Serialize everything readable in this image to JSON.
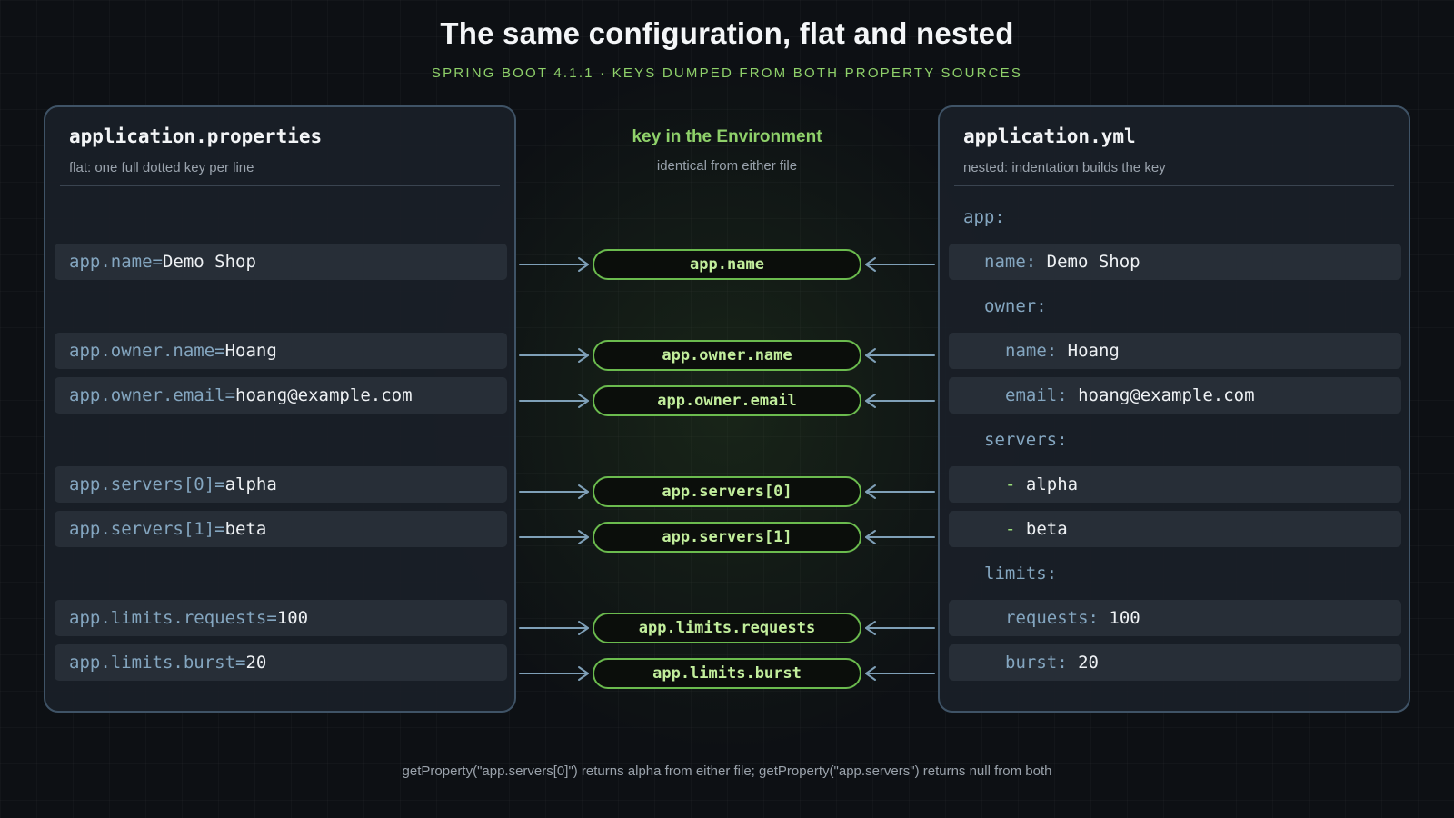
{
  "title": "The same configuration, flat and nested",
  "subtitle": "SPRING BOOT 4.1.1 · KEYS DUMPED FROM BOTH PROPERTY SOURCES",
  "left_panel": {
    "title": "application.properties",
    "subtitle": "flat: one full dotted key per line",
    "lines": [
      {
        "key": "app.name",
        "eq": "=",
        "value": "Demo Shop"
      },
      {
        "key": "app.owner.name",
        "eq": "=",
        "value": "Hoang"
      },
      {
        "key": "app.owner.email",
        "eq": "=",
        "value": "hoang@example.com"
      },
      {
        "key": "app.servers[0]",
        "eq": "=",
        "value": "alpha"
      },
      {
        "key": "app.servers[1]",
        "eq": "=",
        "value": "beta"
      },
      {
        "key": "app.limits.requests",
        "eq": "=",
        "value": "100"
      },
      {
        "key": "app.limits.burst",
        "eq": "=",
        "value": "20"
      }
    ]
  },
  "center": {
    "title": "key in the Environment",
    "subtitle": "identical from either file",
    "keys": [
      "app.name",
      "app.owner.name",
      "app.owner.email",
      "app.servers[0]",
      "app.servers[1]",
      "app.limits.requests",
      "app.limits.burst"
    ]
  },
  "right_panel": {
    "title": "application.yml",
    "subtitle": "nested: indentation builds the key",
    "lines": [
      {
        "key": "app:",
        "value": "",
        "dash": ""
      },
      {
        "key": "name:",
        "value": "Demo Shop",
        "dash": ""
      },
      {
        "key": "owner:",
        "value": "",
        "dash": ""
      },
      {
        "key": "name:",
        "value": "Hoang",
        "dash": ""
      },
      {
        "key": "email:",
        "value": "hoang@example.com",
        "dash": ""
      },
      {
        "key": "servers:",
        "value": "",
        "dash": ""
      },
      {
        "key": "",
        "value": "alpha",
        "dash": "-"
      },
      {
        "key": "",
        "value": "beta",
        "dash": "-"
      },
      {
        "key": "limits:",
        "value": "",
        "dash": ""
      },
      {
        "key": "requests:",
        "value": "100",
        "dash": ""
      },
      {
        "key": "burst:",
        "value": "20",
        "dash": ""
      }
    ]
  },
  "footer": "getProperty(\"app.servers[0]\") returns alpha from either file; getProperty(\"app.servers\") returns null from both",
  "colors": {
    "accent_green": "#8fd16a",
    "pill_border": "#6bbb4e",
    "key_blue": "#84a6c0",
    "panel_border": "#3f5366",
    "arrow": "#7fa0b8"
  }
}
